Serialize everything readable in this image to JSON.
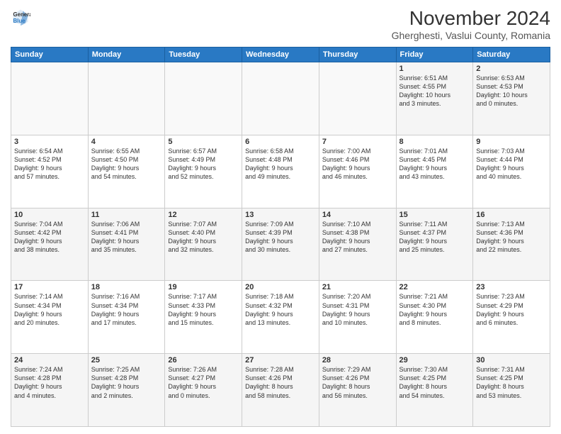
{
  "logo": {
    "line1": "General",
    "line2": "Blue"
  },
  "title": "November 2024",
  "location": "Gherghesti, Vaslui County, Romania",
  "weekdays": [
    "Sunday",
    "Monday",
    "Tuesday",
    "Wednesday",
    "Thursday",
    "Friday",
    "Saturday"
  ],
  "weeks": [
    [
      {
        "day": "",
        "info": ""
      },
      {
        "day": "",
        "info": ""
      },
      {
        "day": "",
        "info": ""
      },
      {
        "day": "",
        "info": ""
      },
      {
        "day": "",
        "info": ""
      },
      {
        "day": "1",
        "info": "Sunrise: 6:51 AM\nSunset: 4:55 PM\nDaylight: 10 hours\nand 3 minutes."
      },
      {
        "day": "2",
        "info": "Sunrise: 6:53 AM\nSunset: 4:53 PM\nDaylight: 10 hours\nand 0 minutes."
      }
    ],
    [
      {
        "day": "3",
        "info": "Sunrise: 6:54 AM\nSunset: 4:52 PM\nDaylight: 9 hours\nand 57 minutes."
      },
      {
        "day": "4",
        "info": "Sunrise: 6:55 AM\nSunset: 4:50 PM\nDaylight: 9 hours\nand 54 minutes."
      },
      {
        "day": "5",
        "info": "Sunrise: 6:57 AM\nSunset: 4:49 PM\nDaylight: 9 hours\nand 52 minutes."
      },
      {
        "day": "6",
        "info": "Sunrise: 6:58 AM\nSunset: 4:48 PM\nDaylight: 9 hours\nand 49 minutes."
      },
      {
        "day": "7",
        "info": "Sunrise: 7:00 AM\nSunset: 4:46 PM\nDaylight: 9 hours\nand 46 minutes."
      },
      {
        "day": "8",
        "info": "Sunrise: 7:01 AM\nSunset: 4:45 PM\nDaylight: 9 hours\nand 43 minutes."
      },
      {
        "day": "9",
        "info": "Sunrise: 7:03 AM\nSunset: 4:44 PM\nDaylight: 9 hours\nand 40 minutes."
      }
    ],
    [
      {
        "day": "10",
        "info": "Sunrise: 7:04 AM\nSunset: 4:42 PM\nDaylight: 9 hours\nand 38 minutes."
      },
      {
        "day": "11",
        "info": "Sunrise: 7:06 AM\nSunset: 4:41 PM\nDaylight: 9 hours\nand 35 minutes."
      },
      {
        "day": "12",
        "info": "Sunrise: 7:07 AM\nSunset: 4:40 PM\nDaylight: 9 hours\nand 32 minutes."
      },
      {
        "day": "13",
        "info": "Sunrise: 7:09 AM\nSunset: 4:39 PM\nDaylight: 9 hours\nand 30 minutes."
      },
      {
        "day": "14",
        "info": "Sunrise: 7:10 AM\nSunset: 4:38 PM\nDaylight: 9 hours\nand 27 minutes."
      },
      {
        "day": "15",
        "info": "Sunrise: 7:11 AM\nSunset: 4:37 PM\nDaylight: 9 hours\nand 25 minutes."
      },
      {
        "day": "16",
        "info": "Sunrise: 7:13 AM\nSunset: 4:36 PM\nDaylight: 9 hours\nand 22 minutes."
      }
    ],
    [
      {
        "day": "17",
        "info": "Sunrise: 7:14 AM\nSunset: 4:34 PM\nDaylight: 9 hours\nand 20 minutes."
      },
      {
        "day": "18",
        "info": "Sunrise: 7:16 AM\nSunset: 4:34 PM\nDaylight: 9 hours\nand 17 minutes."
      },
      {
        "day": "19",
        "info": "Sunrise: 7:17 AM\nSunset: 4:33 PM\nDaylight: 9 hours\nand 15 minutes."
      },
      {
        "day": "20",
        "info": "Sunrise: 7:18 AM\nSunset: 4:32 PM\nDaylight: 9 hours\nand 13 minutes."
      },
      {
        "day": "21",
        "info": "Sunrise: 7:20 AM\nSunset: 4:31 PM\nDaylight: 9 hours\nand 10 minutes."
      },
      {
        "day": "22",
        "info": "Sunrise: 7:21 AM\nSunset: 4:30 PM\nDaylight: 9 hours\nand 8 minutes."
      },
      {
        "day": "23",
        "info": "Sunrise: 7:23 AM\nSunset: 4:29 PM\nDaylight: 9 hours\nand 6 minutes."
      }
    ],
    [
      {
        "day": "24",
        "info": "Sunrise: 7:24 AM\nSunset: 4:28 PM\nDaylight: 9 hours\nand 4 minutes."
      },
      {
        "day": "25",
        "info": "Sunrise: 7:25 AM\nSunset: 4:28 PM\nDaylight: 9 hours\nand 2 minutes."
      },
      {
        "day": "26",
        "info": "Sunrise: 7:26 AM\nSunset: 4:27 PM\nDaylight: 9 hours\nand 0 minutes."
      },
      {
        "day": "27",
        "info": "Sunrise: 7:28 AM\nSunset: 4:26 PM\nDaylight: 8 hours\nand 58 minutes."
      },
      {
        "day": "28",
        "info": "Sunrise: 7:29 AM\nSunset: 4:26 PM\nDaylight: 8 hours\nand 56 minutes."
      },
      {
        "day": "29",
        "info": "Sunrise: 7:30 AM\nSunset: 4:25 PM\nDaylight: 8 hours\nand 54 minutes."
      },
      {
        "day": "30",
        "info": "Sunrise: 7:31 AM\nSunset: 4:25 PM\nDaylight: 8 hours\nand 53 minutes."
      }
    ]
  ]
}
